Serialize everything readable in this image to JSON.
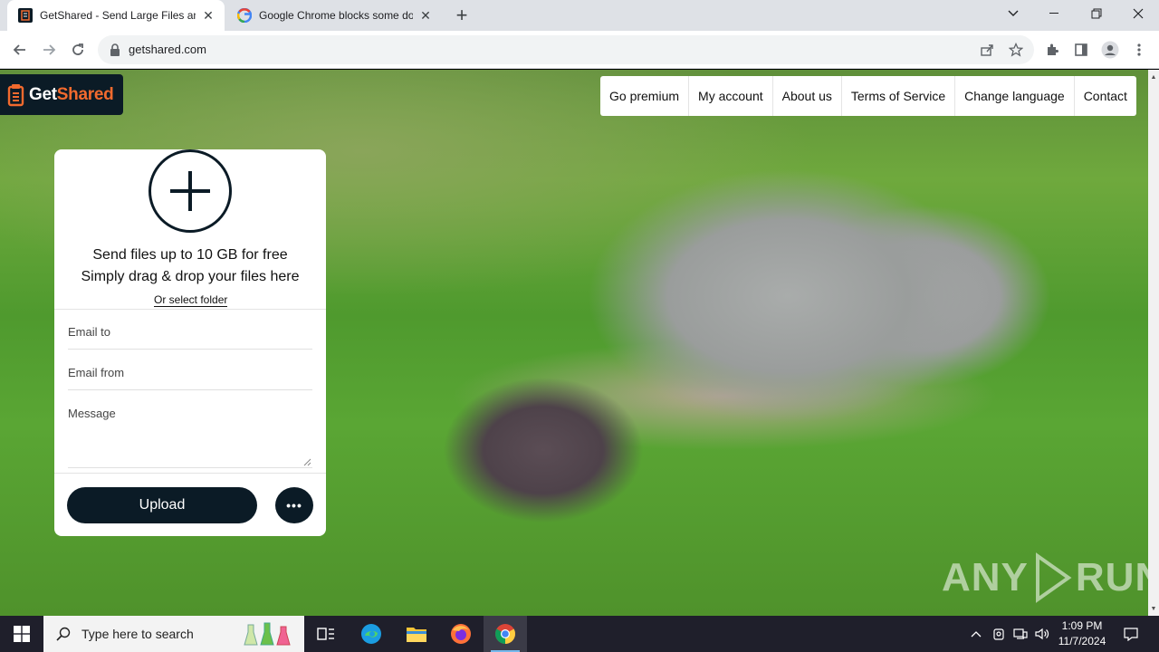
{
  "browser": {
    "tabs": [
      {
        "title": "GetShared - Send Large Files and",
        "favicon": "getshared-favicon",
        "active": true
      },
      {
        "title": "Google Chrome blocks some do",
        "favicon": "google-favicon",
        "active": false
      }
    ],
    "url": "getshared.com"
  },
  "site": {
    "logo": {
      "get": "Get",
      "shared": "Shared"
    },
    "nav": [
      "Go premium",
      "My account",
      "About us",
      "Terms of Service",
      "Change language",
      "Contact"
    ],
    "upload_panel": {
      "line1": "Send files up to 10 GB for free",
      "line2": "Simply drag & drop your files here",
      "select_folder": "Or select folder",
      "email_to_placeholder": "Email to",
      "email_from_placeholder": "Email from",
      "message_placeholder": "Message",
      "upload_label": "Upload",
      "more_label": "•••"
    },
    "watermark": {
      "left": "ANY",
      "right": "RUN"
    }
  },
  "taskbar": {
    "search_placeholder": "Type here to search",
    "time": "1:09 PM",
    "date": "11/7/2024"
  },
  "colors": {
    "brand_dark": "#0b1b26",
    "brand_orange": "#f26a2e"
  }
}
